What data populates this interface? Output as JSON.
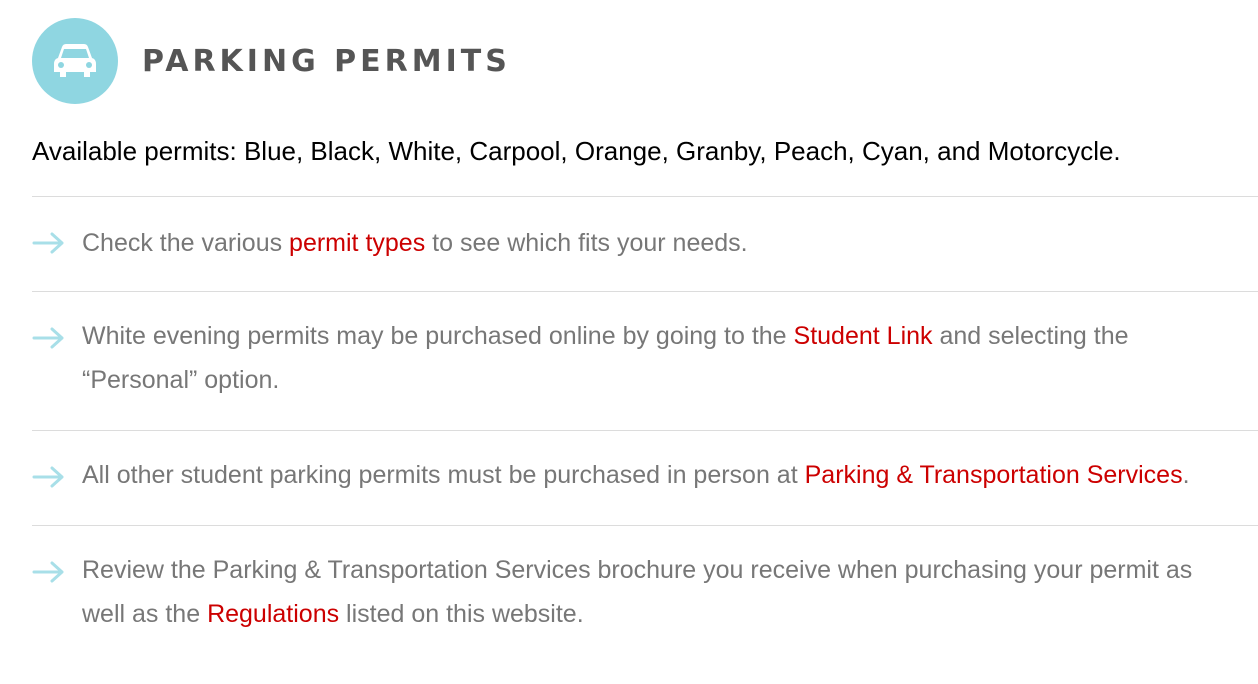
{
  "header": {
    "icon": "car-icon",
    "icon_bg": "#8fd6e1",
    "title": "PARKING PERMITS"
  },
  "intro": "Available permits: Blue, Black, White, Carpool, Orange, Granby, Peach, Cyan, and Motorcycle.",
  "colors": {
    "link": "#cc0000",
    "body_text": "#777777",
    "arrow": "#a8dfe8"
  },
  "items": [
    {
      "icon": "arrow-right-icon",
      "before": "Check the various ",
      "link": "permit types",
      "after": " to see which fits your needs."
    },
    {
      "icon": "arrow-right-icon",
      "before": "White evening permits may be purchased online by going to the ",
      "link": "Student Link",
      "after": " and selecting the “Personal” option."
    },
    {
      "icon": "arrow-right-icon",
      "before": "All other student parking permits must be purchased in person at ",
      "link": "Parking & Transportation Services",
      "after": "."
    },
    {
      "icon": "arrow-right-icon",
      "before": "Review the Parking & Transportation Services brochure you receive when purchasing your permit as well as the ",
      "link": "Regulations",
      "after": " listed on this website."
    }
  ]
}
